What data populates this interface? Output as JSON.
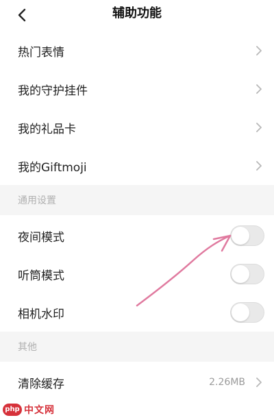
{
  "header": {
    "title": "辅助功能",
    "back_icon": "chevron-left-icon"
  },
  "main_list": [
    {
      "label": "热门表情"
    },
    {
      "label": "我的守护挂件"
    },
    {
      "label": "我的礼品卡"
    },
    {
      "label": "我的Giftmoji"
    }
  ],
  "general_settings": {
    "title": "通用设置",
    "items": [
      {
        "label": "夜间模式",
        "toggle_on": false
      },
      {
        "label": "听筒模式",
        "toggle_on": false
      },
      {
        "label": "相机水印",
        "toggle_on": false
      }
    ]
  },
  "other": {
    "title": "其他",
    "items": [
      {
        "label": "清除缓存",
        "value": "2.26MB"
      }
    ]
  },
  "annotation": {
    "color": "#e07a9f"
  },
  "watermark": {
    "logo_text": "php",
    "text": "中文网",
    "color": "#d6313a"
  },
  "colors": {
    "section_bg": "#f5f5f5",
    "toggle_off": "#e9e9e9",
    "chevron": "#b8b8b8"
  }
}
